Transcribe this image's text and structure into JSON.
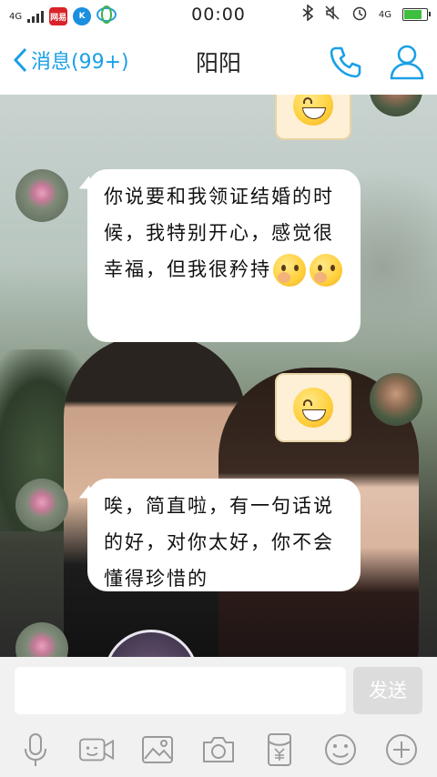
{
  "status_bar": {
    "network": "4G",
    "app_icon_text": "网易",
    "app_icon2_text": "K",
    "time": "00:00",
    "right_network": "4G",
    "battery_level": 0.85,
    "battery_color": "#3fbf3f"
  },
  "nav": {
    "back_label": "消息(99+)",
    "title": "阳阳",
    "accent": "#1aa0e6"
  },
  "messages": [
    {
      "sender": "other",
      "text": "你说要和我领证结婚的时候，我特别开心，感觉很幸福，但我很矜持",
      "emojis": [
        "shh-emoji",
        "shh-emoji"
      ]
    },
    {
      "sender": "other",
      "text": "唉，简直啦，有一句话说的好，对你太好，你不会懂得珍惜的"
    }
  ],
  "input": {
    "placeholder": "",
    "value": ""
  },
  "send_label": "发送",
  "toolbar_icons": [
    "microphone-icon",
    "video-call-icon",
    "image-icon",
    "camera-icon",
    "red-packet-icon",
    "emoji-icon",
    "plus-icon"
  ]
}
